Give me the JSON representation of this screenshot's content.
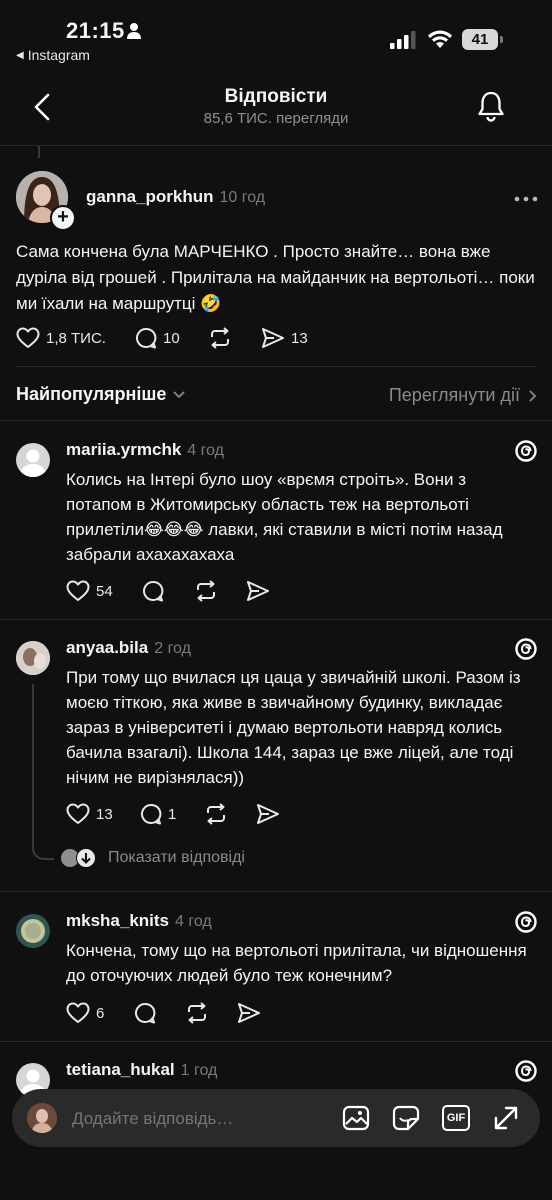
{
  "status_bar": {
    "time": "21:15",
    "back_app": "Instagram",
    "battery": "41"
  },
  "header": {
    "title": "Відповісти",
    "subtitle": "85,6 ТИС. перегляди"
  },
  "post": {
    "username": "ganna_porkhun",
    "time": "10 год",
    "text": "Сама кончена була МАРЧЕНКО . Просто знайте… вона вже дуріла від грошей . Прилітала на майданчик на вертольоті… поки ми їхали на маршрутці 🤣",
    "likes": "1,8 ТИС.",
    "comments": "10",
    "shares": "13"
  },
  "sort": {
    "label": "Найпопулярніше",
    "activity_link": "Переглянути дії"
  },
  "comments": [
    {
      "username": "mariia.yrmchk",
      "time": "4 год",
      "text": "Колись на Інтері було шоу «врємя строіть». Вони з потапом в Житомирську область теж на вертольоті прилетіли😂😂😂 лавки, які ставили в місті потім назад забрали ахахахахаха",
      "likes": "54"
    },
    {
      "username": "anyaa.bila",
      "time": "2 год",
      "text": "При тому що вчилася ця цаца у звичайній школі. Разом із моєю тіткою, яка живе в звичайному будинку, викладає зараз в університеті і думаю вертольоти навряд колись бачила взагалі). Школа 144, зараз це вже ліцей, але тоді нічим не вирізнялася))",
      "likes": "13",
      "comments": "1",
      "show_replies": "Показати відповіді"
    },
    {
      "username": "mksha_knits",
      "time": "4 год",
      "text": "Кончена, тому що на вертольоті прилітала, чи відношення до оточуючих людей було теж конечним?",
      "likes": "6"
    },
    {
      "username": "tetiana_hukal",
      "time": "1 год"
    }
  ],
  "composer": {
    "placeholder": "Додайте відповідь…",
    "gif_label": "GIF"
  }
}
